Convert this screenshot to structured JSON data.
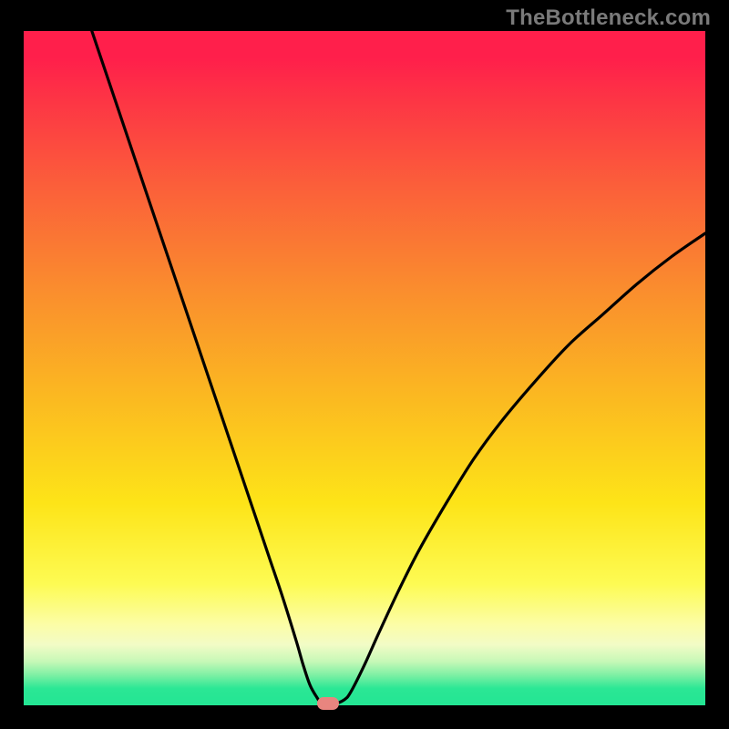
{
  "watermark": "TheBottleneck.com",
  "chart_data": {
    "type": "line",
    "title": "",
    "xlabel": "",
    "ylabel": "",
    "xlim": [
      0,
      100
    ],
    "ylim": [
      0,
      100
    ],
    "grid": false,
    "series": [
      {
        "name": "bottleneck_curve",
        "x": [
          10,
          12,
          14,
          16,
          18,
          20,
          22,
          24,
          26,
          28,
          30,
          32,
          34,
          36,
          38,
          40,
          41,
          42,
          43,
          43.8,
          45.5,
          47,
          48,
          50,
          52,
          55,
          58,
          62,
          66,
          70,
          75,
          80,
          85,
          90,
          95,
          100
        ],
        "y": [
          100,
          94,
          88,
          82,
          76,
          70,
          64,
          58,
          52,
          46,
          40,
          34,
          28,
          22,
          16,
          9.5,
          6,
          3,
          1.2,
          0.2,
          0.2,
          0.8,
          2,
          6,
          10.5,
          17,
          23,
          30,
          36.5,
          42,
          48,
          53.5,
          58,
          62.5,
          66.5,
          70
        ]
      }
    ],
    "marker": {
      "x": 44.6,
      "y": 0,
      "color": "#e8857f"
    },
    "background_gradient": {
      "top": "#ff1f4b",
      "mid": "#fbb821",
      "low": "#fdfb53",
      "bottom": "#23e593"
    }
  }
}
